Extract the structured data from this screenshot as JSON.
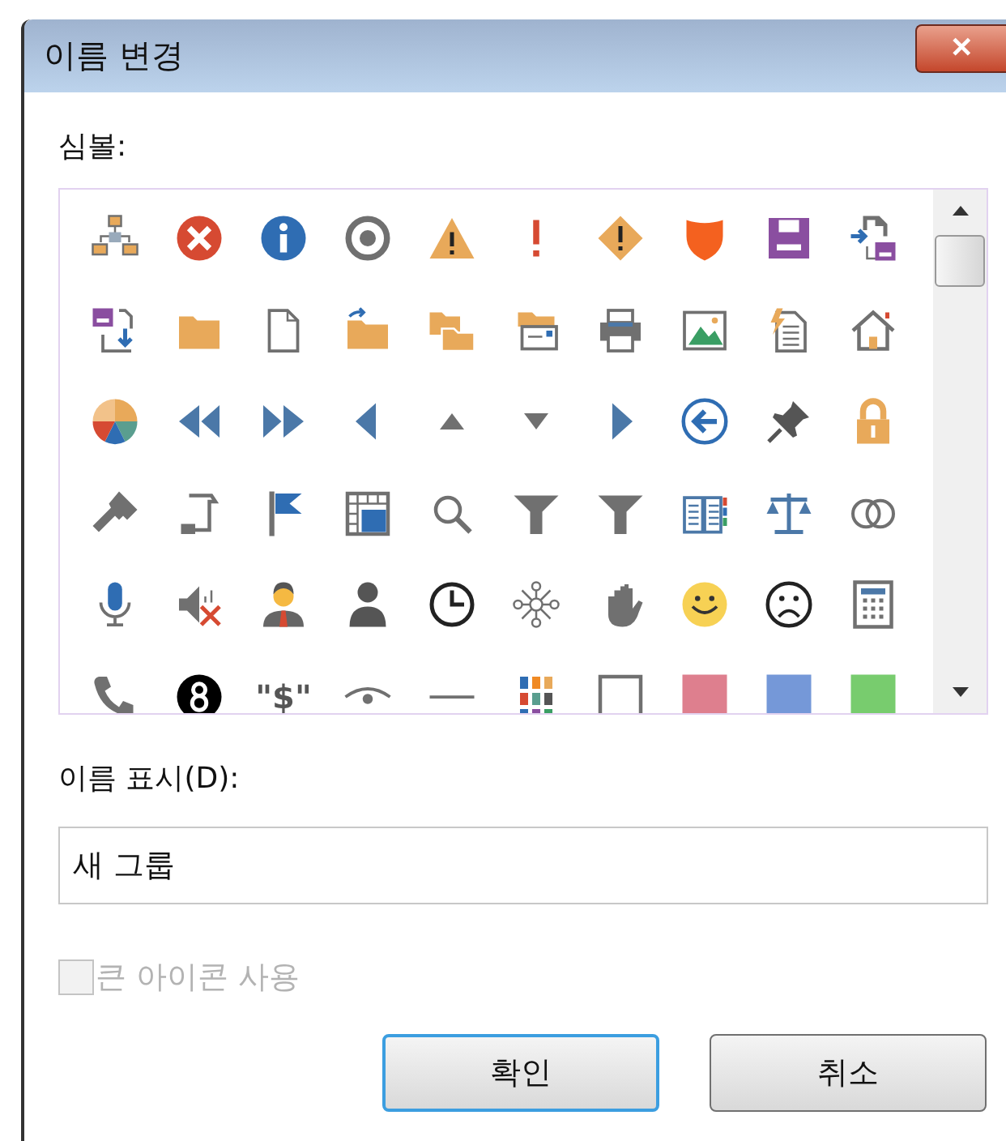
{
  "window": {
    "title": "이름 변경",
    "close_glyph": "✕"
  },
  "symbols": {
    "label": "심볼:",
    "dollar_symbol": "\"$\""
  },
  "display_name": {
    "label": "이름 표시(D):",
    "value": "새 그룹"
  },
  "large_icons": {
    "label": "큰 아이콘 사용",
    "checked": false,
    "disabled": true
  },
  "buttons": [
    {
      "label": "확인",
      "default": true
    },
    {
      "label": "취소",
      "default": false
    }
  ]
}
